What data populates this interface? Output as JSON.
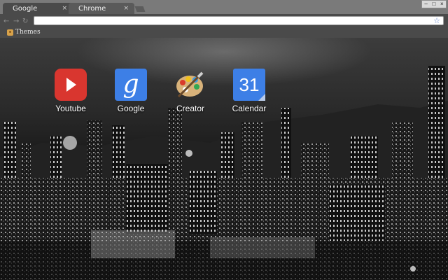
{
  "tabs": [
    {
      "label": "Google",
      "close": "×"
    },
    {
      "label": "Chrome",
      "close": "×"
    }
  ],
  "window_controls": [
    "–",
    "□",
    "×"
  ],
  "nav": {
    "back": "←",
    "forward": "→",
    "reload": "↻"
  },
  "omnibox": {
    "value": "",
    "star": "☆"
  },
  "bookmarks": [
    {
      "label": "Themes",
      "icon": "themes-icon"
    }
  ],
  "apps": [
    {
      "label": "Youtube",
      "icon": "youtube-icon"
    },
    {
      "label": "Google",
      "icon": "google-icon",
      "glyph": "g"
    },
    {
      "label": "Creator",
      "icon": "palette-icon"
    },
    {
      "label": "Calendar",
      "icon": "calendar-icon",
      "glyph": "31"
    }
  ],
  "colors": {
    "tab_active": "#4a4a4a",
    "toolbar": "#4a4a4a",
    "accent_blue": "#3d7fe6",
    "youtube_red": "#d9362f"
  }
}
